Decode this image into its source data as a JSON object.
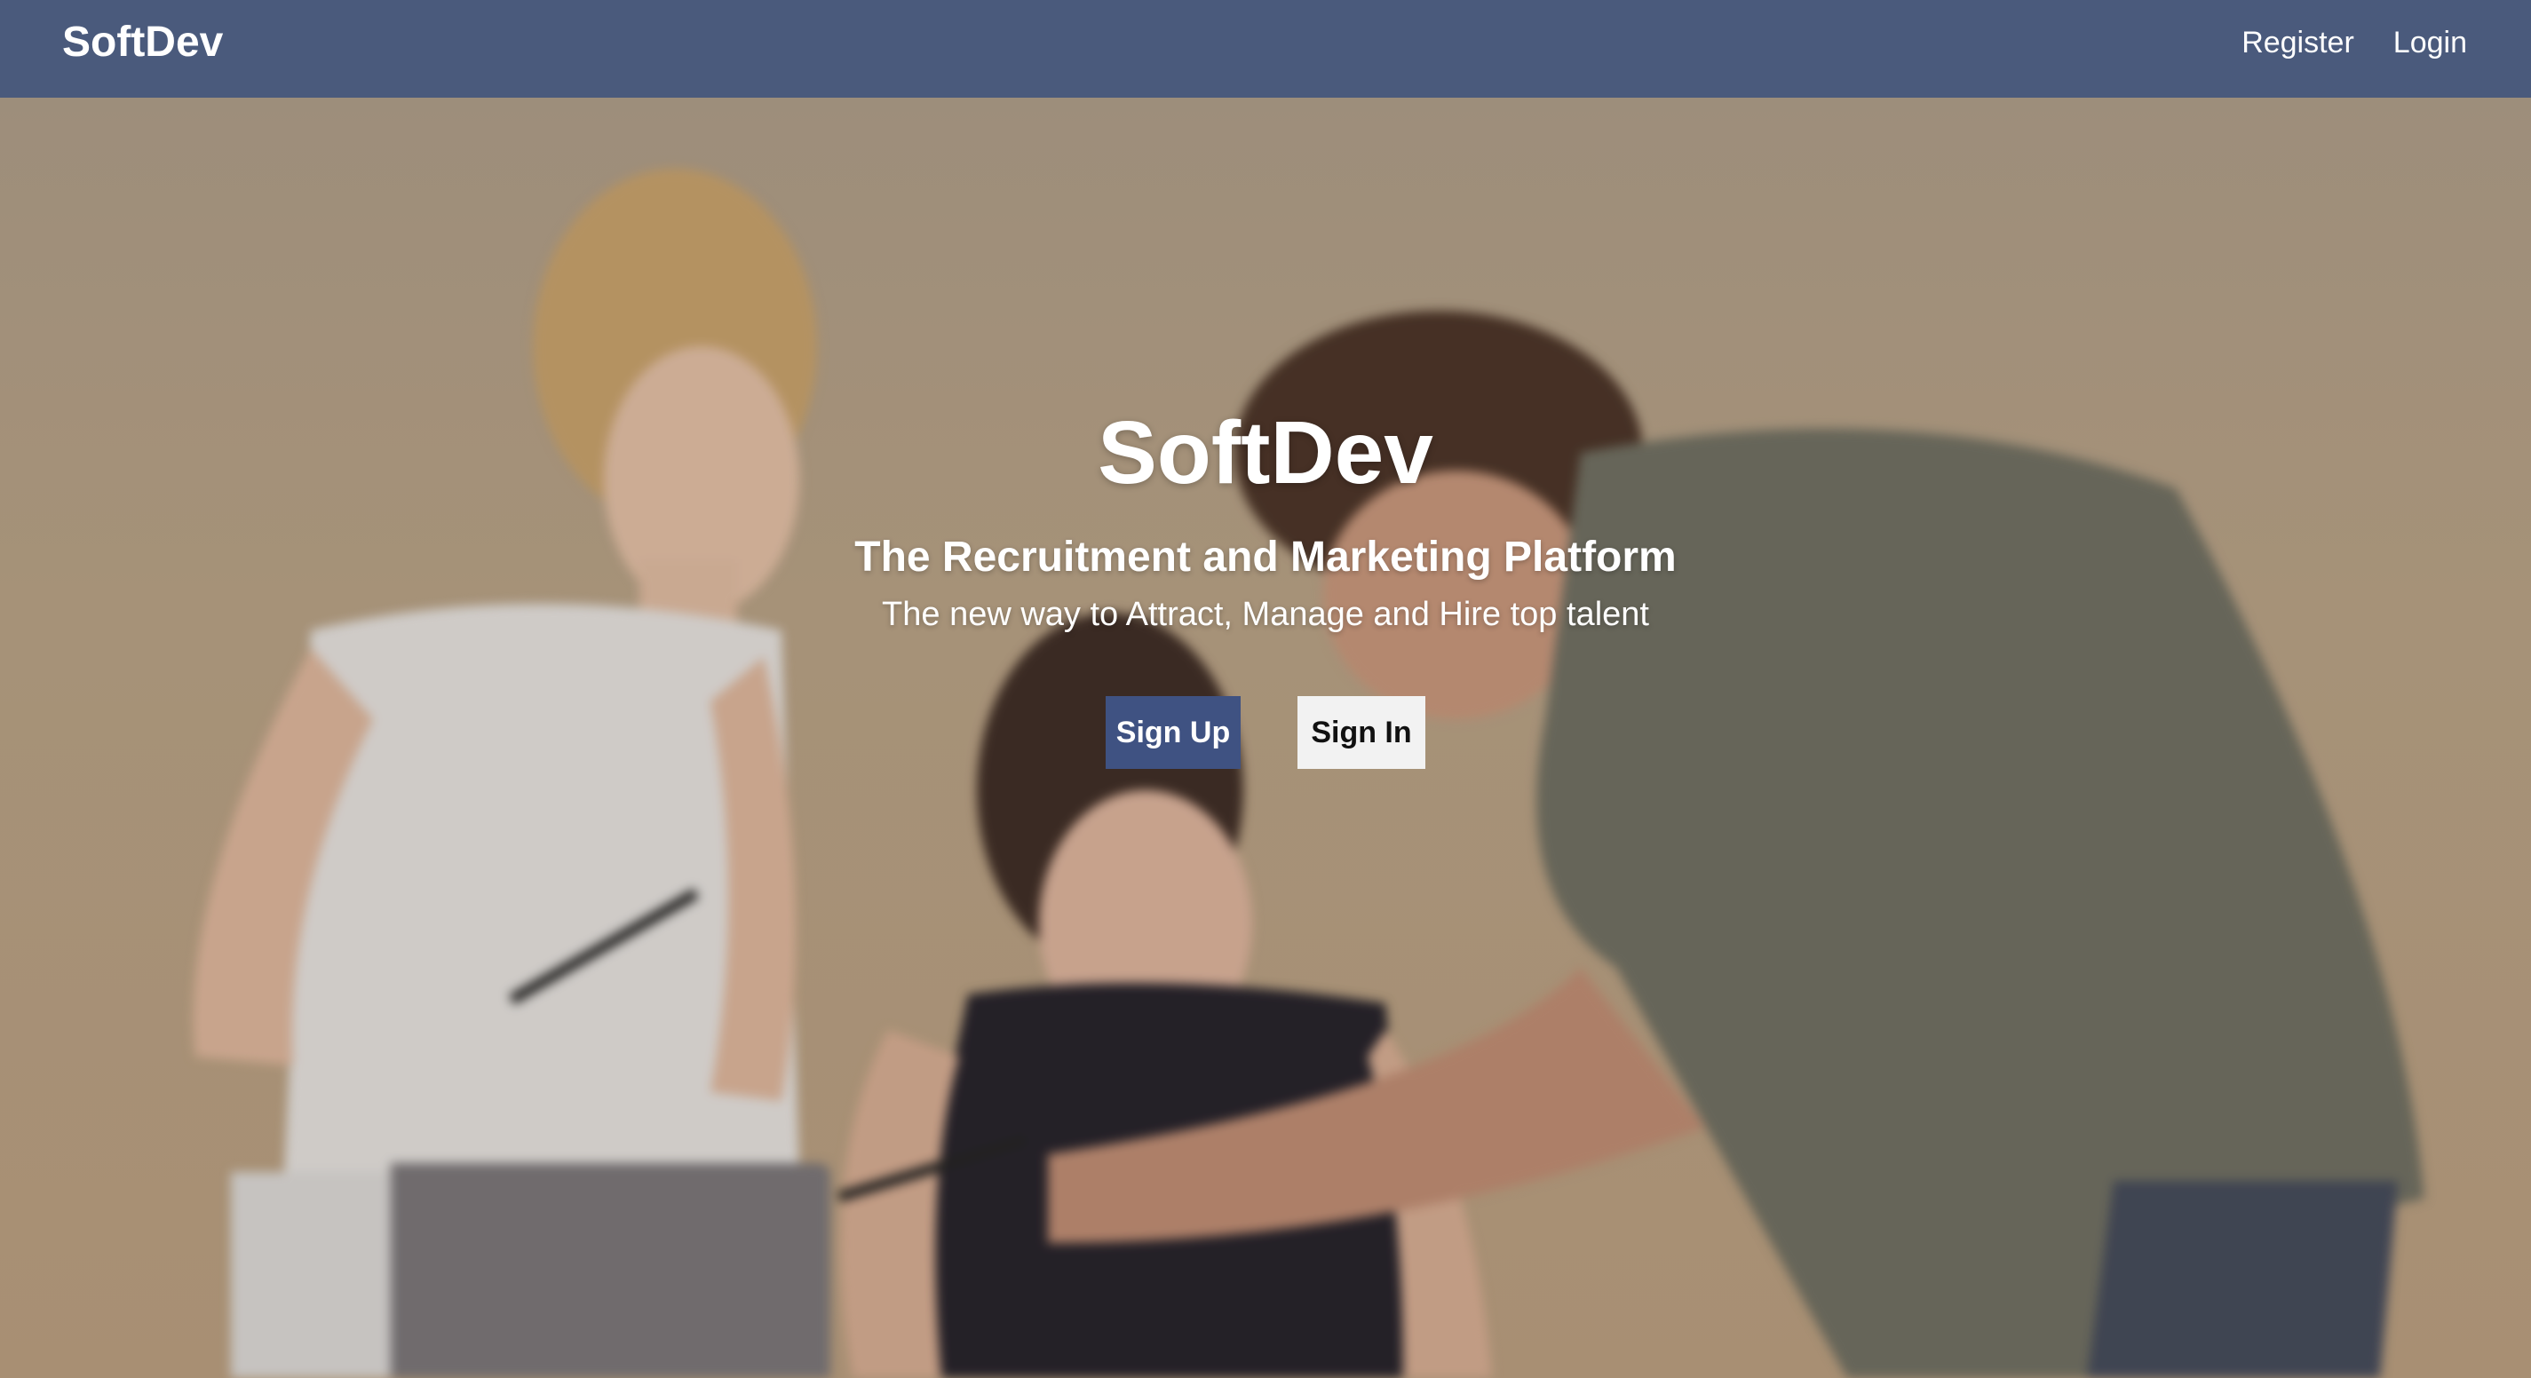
{
  "navbar": {
    "brand": "SoftDev",
    "links": {
      "register": "Register",
      "login": "Login"
    },
    "background_color": "#4a5a7c"
  },
  "hero": {
    "title": "SoftDev",
    "subtitle": "The Recruitment and Marketing Platform",
    "tagline": "The new way to Attract, Manage and Hire top talent",
    "buttons": {
      "sign_up": "Sign Up",
      "sign_in": "Sign In"
    },
    "colors": {
      "primary_button": "#3f5282",
      "secondary_button": "#f2f2f2"
    }
  }
}
